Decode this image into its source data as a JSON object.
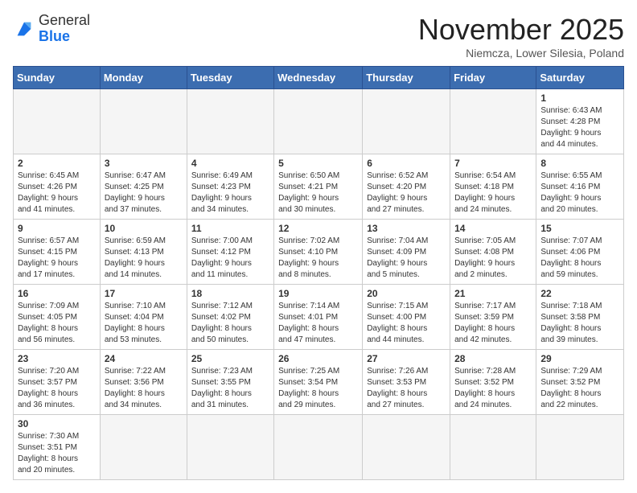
{
  "header": {
    "logo_text_general": "General",
    "logo_text_blue": "Blue",
    "month_title": "November 2025",
    "location": "Niemcza, Lower Silesia, Poland"
  },
  "weekdays": [
    "Sunday",
    "Monday",
    "Tuesday",
    "Wednesday",
    "Thursday",
    "Friday",
    "Saturday"
  ],
  "days": [
    {
      "date": "",
      "info": ""
    },
    {
      "date": "",
      "info": ""
    },
    {
      "date": "",
      "info": ""
    },
    {
      "date": "",
      "info": ""
    },
    {
      "date": "",
      "info": ""
    },
    {
      "date": "",
      "info": ""
    },
    {
      "date": "1",
      "info": "Sunrise: 6:43 AM\nSunset: 4:28 PM\nDaylight: 9 hours\nand 44 minutes."
    },
    {
      "date": "2",
      "info": "Sunrise: 6:45 AM\nSunset: 4:26 PM\nDaylight: 9 hours\nand 41 minutes."
    },
    {
      "date": "3",
      "info": "Sunrise: 6:47 AM\nSunset: 4:25 PM\nDaylight: 9 hours\nand 37 minutes."
    },
    {
      "date": "4",
      "info": "Sunrise: 6:49 AM\nSunset: 4:23 PM\nDaylight: 9 hours\nand 34 minutes."
    },
    {
      "date": "5",
      "info": "Sunrise: 6:50 AM\nSunset: 4:21 PM\nDaylight: 9 hours\nand 30 minutes."
    },
    {
      "date": "6",
      "info": "Sunrise: 6:52 AM\nSunset: 4:20 PM\nDaylight: 9 hours\nand 27 minutes."
    },
    {
      "date": "7",
      "info": "Sunrise: 6:54 AM\nSunset: 4:18 PM\nDaylight: 9 hours\nand 24 minutes."
    },
    {
      "date": "8",
      "info": "Sunrise: 6:55 AM\nSunset: 4:16 PM\nDaylight: 9 hours\nand 20 minutes."
    },
    {
      "date": "9",
      "info": "Sunrise: 6:57 AM\nSunset: 4:15 PM\nDaylight: 9 hours\nand 17 minutes."
    },
    {
      "date": "10",
      "info": "Sunrise: 6:59 AM\nSunset: 4:13 PM\nDaylight: 9 hours\nand 14 minutes."
    },
    {
      "date": "11",
      "info": "Sunrise: 7:00 AM\nSunset: 4:12 PM\nDaylight: 9 hours\nand 11 minutes."
    },
    {
      "date": "12",
      "info": "Sunrise: 7:02 AM\nSunset: 4:10 PM\nDaylight: 9 hours\nand 8 minutes."
    },
    {
      "date": "13",
      "info": "Sunrise: 7:04 AM\nSunset: 4:09 PM\nDaylight: 9 hours\nand 5 minutes."
    },
    {
      "date": "14",
      "info": "Sunrise: 7:05 AM\nSunset: 4:08 PM\nDaylight: 9 hours\nand 2 minutes."
    },
    {
      "date": "15",
      "info": "Sunrise: 7:07 AM\nSunset: 4:06 PM\nDaylight: 8 hours\nand 59 minutes."
    },
    {
      "date": "16",
      "info": "Sunrise: 7:09 AM\nSunset: 4:05 PM\nDaylight: 8 hours\nand 56 minutes."
    },
    {
      "date": "17",
      "info": "Sunrise: 7:10 AM\nSunset: 4:04 PM\nDaylight: 8 hours\nand 53 minutes."
    },
    {
      "date": "18",
      "info": "Sunrise: 7:12 AM\nSunset: 4:02 PM\nDaylight: 8 hours\nand 50 minutes."
    },
    {
      "date": "19",
      "info": "Sunrise: 7:14 AM\nSunset: 4:01 PM\nDaylight: 8 hours\nand 47 minutes."
    },
    {
      "date": "20",
      "info": "Sunrise: 7:15 AM\nSunset: 4:00 PM\nDaylight: 8 hours\nand 44 minutes."
    },
    {
      "date": "21",
      "info": "Sunrise: 7:17 AM\nSunset: 3:59 PM\nDaylight: 8 hours\nand 42 minutes."
    },
    {
      "date": "22",
      "info": "Sunrise: 7:18 AM\nSunset: 3:58 PM\nDaylight: 8 hours\nand 39 minutes."
    },
    {
      "date": "23",
      "info": "Sunrise: 7:20 AM\nSunset: 3:57 PM\nDaylight: 8 hours\nand 36 minutes."
    },
    {
      "date": "24",
      "info": "Sunrise: 7:22 AM\nSunset: 3:56 PM\nDaylight: 8 hours\nand 34 minutes."
    },
    {
      "date": "25",
      "info": "Sunrise: 7:23 AM\nSunset: 3:55 PM\nDaylight: 8 hours\nand 31 minutes."
    },
    {
      "date": "26",
      "info": "Sunrise: 7:25 AM\nSunset: 3:54 PM\nDaylight: 8 hours\nand 29 minutes."
    },
    {
      "date": "27",
      "info": "Sunrise: 7:26 AM\nSunset: 3:53 PM\nDaylight: 8 hours\nand 27 minutes."
    },
    {
      "date": "28",
      "info": "Sunrise: 7:28 AM\nSunset: 3:52 PM\nDaylight: 8 hours\nand 24 minutes."
    },
    {
      "date": "29",
      "info": "Sunrise: 7:29 AM\nSunset: 3:52 PM\nDaylight: 8 hours\nand 22 minutes."
    },
    {
      "date": "30",
      "info": "Sunrise: 7:30 AM\nSunset: 3:51 PM\nDaylight: 8 hours\nand 20 minutes."
    },
    {
      "date": "",
      "info": ""
    },
    {
      "date": "",
      "info": ""
    },
    {
      "date": "",
      "info": ""
    },
    {
      "date": "",
      "info": ""
    },
    {
      "date": "",
      "info": ""
    },
    {
      "date": "",
      "info": ""
    }
  ]
}
